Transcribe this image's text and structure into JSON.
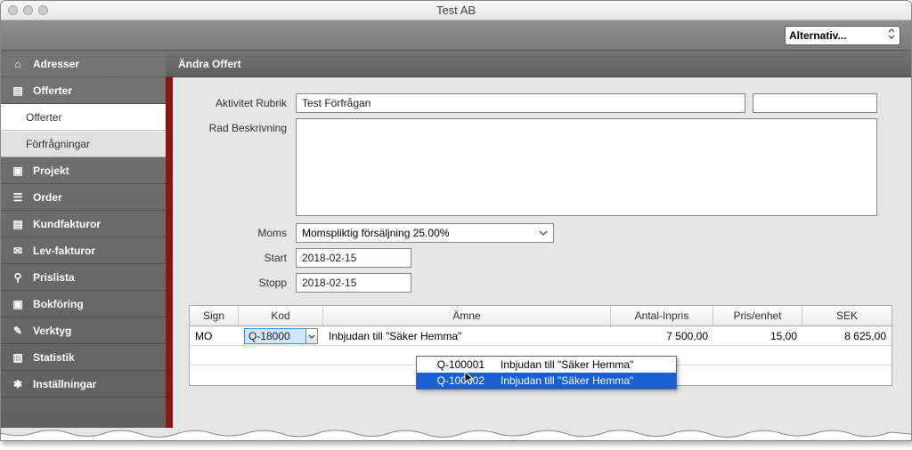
{
  "window_title": "Test AB",
  "toolbar": {
    "alternativ_label": "Alternativ..."
  },
  "sidebar": {
    "items": [
      {
        "label": "Adresser",
        "icon": "home-icon",
        "glyph": "⌂"
      },
      {
        "label": "Offerter",
        "icon": "document-icon",
        "glyph": "▤"
      },
      {
        "label": "Offerter",
        "sub": true,
        "active": true
      },
      {
        "label": "Förfrågningar",
        "sub": true
      },
      {
        "label": "Projekt",
        "icon": "folder-icon",
        "glyph": "▣"
      },
      {
        "label": "Order",
        "icon": "list-icon",
        "glyph": "☰"
      },
      {
        "label": "Kundfakturor",
        "icon": "invoice-icon",
        "glyph": "▤"
      },
      {
        "label": "Lev-fakturor",
        "icon": "mail-icon",
        "glyph": "✉"
      },
      {
        "label": "Prislista",
        "icon": "tag-icon",
        "glyph": "⚲"
      },
      {
        "label": "Bokföring",
        "icon": "book-icon",
        "glyph": "▣"
      },
      {
        "label": "Verktyg",
        "icon": "wrench-icon",
        "glyph": "✎"
      },
      {
        "label": "Statistik",
        "icon": "chart-icon",
        "glyph": "▥"
      },
      {
        "label": "Inställningar",
        "icon": "gear-icon",
        "glyph": "✱"
      }
    ]
  },
  "header_title": "Ändra Offert",
  "form": {
    "aktivitet_label": "Aktivitet Rubrik",
    "aktivitet_value": "Test Förfrågan",
    "rad_label": "Rad Beskrivning",
    "rad_value": "",
    "moms_label": "Moms",
    "moms_value": "Momspliktig försäljning 25.00%",
    "start_label": "Start",
    "start_value": "2018-02-15",
    "stopp_label": "Stopp",
    "stopp_value": "2018-02-15"
  },
  "table": {
    "headers": {
      "sign": "Sign",
      "kod": "Kod",
      "amne": "Ämne",
      "antal": "Antal-Inpris",
      "pris": "Pris/enhet",
      "sek": "SEK"
    },
    "rows": [
      {
        "sign": "MO",
        "kod": "Q-18000",
        "amne": "Inbjudan till \"Säker Hemma\"",
        "antal": "7 500,00",
        "pris": "15,00",
        "sek": "8 625,00"
      }
    ]
  },
  "dropdown": {
    "options": [
      {
        "code": "Q-100001",
        "desc": "Inbjudan till \"Säker Hemma\""
      },
      {
        "code": "Q-100002",
        "desc": "Inbjudan till \"Säker Hemma\""
      }
    ],
    "selected_index": 1
  }
}
